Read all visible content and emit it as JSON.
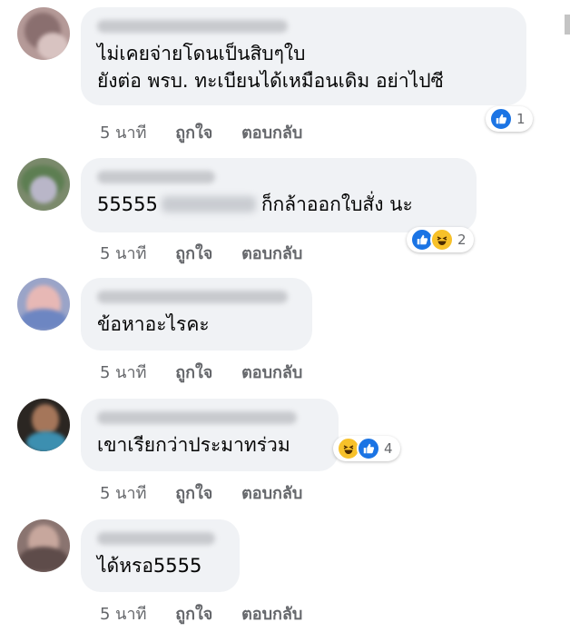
{
  "comments": [
    {
      "lines": [
        "ไม่เคยจ่ายโดนเป็นสิบๆใบ",
        "ยังต่อ พรบ. ทะเบียนได้เหมือนเดิม อย่าไปซี"
      ],
      "time": "5 นาที",
      "like": "ถูกใจ",
      "reply": "ตอบกลับ",
      "reactions": [
        "like"
      ],
      "reaction_count": "1"
    },
    {
      "before": "55555",
      "after": "ก็กล้าออกใบสั่ง นะ",
      "time": "5 นาที",
      "like": "ถูกใจ",
      "reply": "ตอบกลับ",
      "reactions": [
        "like",
        "haha"
      ],
      "reaction_count": "2"
    },
    {
      "lines": [
        "ข้อหาอะไรคะ"
      ],
      "time": "5 นาที",
      "like": "ถูกใจ",
      "reply": "ตอบกลับ"
    },
    {
      "lines": [
        "เขาเรียกว่าประมาทร่วม"
      ],
      "time": "5 นาที",
      "like": "ถูกใจ",
      "reply": "ตอบกลับ",
      "reactions": [
        "haha",
        "like"
      ],
      "reaction_count": "4"
    },
    {
      "lines": [
        "ได้หรอ5555"
      ],
      "time": "5 นาที",
      "like": "ถูกใจ",
      "reply": "ตอบกลับ"
    }
  ],
  "colors": {
    "bubble": "#f0f2f5",
    "like": "#1b74e4",
    "haha": "#f7c12a",
    "meta": "#65676b"
  },
  "icons": {
    "like": "thumbs-up-icon",
    "haha": "laugh-face-icon"
  }
}
